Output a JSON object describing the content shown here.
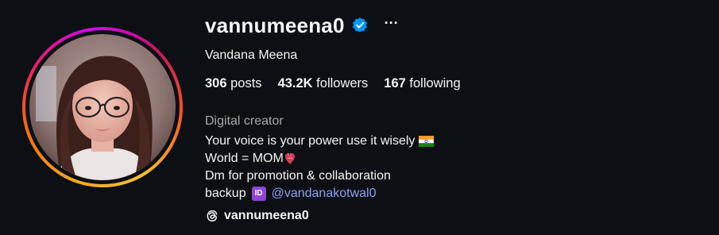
{
  "profile": {
    "username": "vannumeena0",
    "full_name": "Vandana Meena",
    "verified": true,
    "more_options_label": "···",
    "category": "Digital creator"
  },
  "stats": {
    "posts_count": "306",
    "posts_label": " posts",
    "followers_count": "43.2K",
    "followers_label": " followers",
    "following_count": "167",
    "following_label": " following"
  },
  "bio": {
    "line1": "Your voice is your power use it wisely",
    "line2": "World = MOM",
    "line3": "Dm for promotion & collaboration",
    "line4_prefix": "backup",
    "line4_id_badge": "ID",
    "line4_mention": "@vandanakotwal0"
  },
  "threads": {
    "handle": "vannumeena0"
  },
  "icons": {
    "verified": "verified-badge-icon",
    "more": "more-options-icon",
    "flag": "india-flag-icon",
    "heart": "anatomical-heart-icon",
    "id": "id-badge-icon",
    "threads": "threads-icon"
  },
  "colors": {
    "background": "#0c1014",
    "text_primary": "#f5f5f5",
    "text_secondary": "#a8a8a8",
    "link": "#8ea1f5",
    "verified_blue": "#0095f6"
  }
}
